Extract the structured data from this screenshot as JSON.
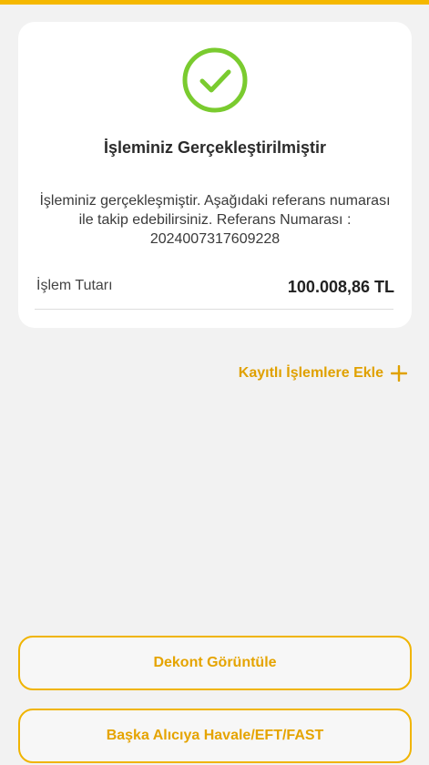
{
  "colors": {
    "accent": "#f5b800",
    "success": "#7acb2f"
  },
  "result": {
    "icon": "check-circle-icon",
    "title": "İşleminiz Gerçekleştirilmiştir",
    "message": "İşleminiz gerçekleşmiştir. Aşağıdaki referans numarası ile takip edebilirsiniz. Referans Numarası : 2024007317609228",
    "amount_label": "İşlem Tutarı",
    "amount_value": "100.008,86 TL"
  },
  "actions": {
    "save_label": "Kayıtlı İşlemlere Ekle",
    "save_icon": "plus-icon",
    "receipt_label": "Dekont Görüntüle",
    "new_transfer_label": "Başka Alıcıya Havale/EFT/FAST"
  }
}
